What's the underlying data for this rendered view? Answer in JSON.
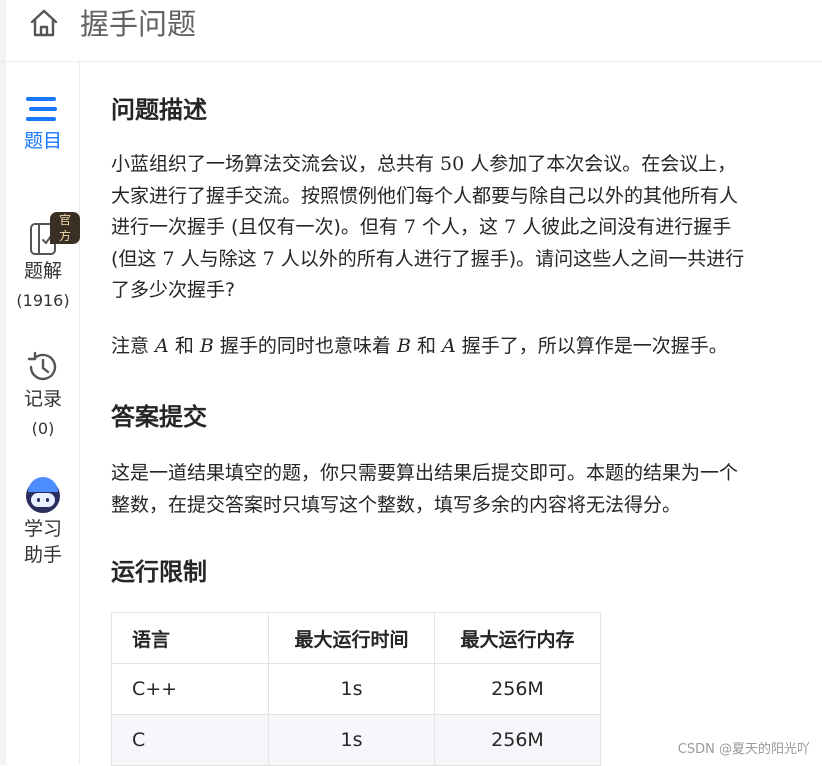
{
  "header": {
    "title": "握手问题",
    "home_icon": "home-icon"
  },
  "sidebar": {
    "accent_color": "#1677ff",
    "items": [
      {
        "id": "problem",
        "label": "题目",
        "icon": "list-icon",
        "active": true
      },
      {
        "id": "solutions",
        "label": "题解",
        "badge": "官方",
        "count": "(1916)",
        "icon": "solution-doc-icon"
      },
      {
        "id": "records",
        "label": "记录",
        "count": "(0)",
        "icon": "history-clock-icon"
      },
      {
        "id": "assistant",
        "label_line1": "学习",
        "label_line2": "助手",
        "icon": "robot-assistant-icon"
      }
    ]
  },
  "sections": {
    "description": {
      "title": "问题描述",
      "lines": [
        [
          "小蓝组织了一场算法交流会议，总共有 ",
          "50",
          " 人参加了本次会议。在会议上，"
        ],
        [
          "大家进行了握手交流。按照惯例他们每个人都要与除自己以外的其他所有人"
        ],
        [
          "进行一次握手 (且仅有一次)。但有 ",
          "7",
          " 个人，这 ",
          "7",
          " 人彼此之间没有进行握手"
        ],
        [
          "(但这 ",
          "7",
          " 人与除这 ",
          "7",
          " 人以外的所有人进行了握手)。请问这些人之间一共进行"
        ],
        [
          "了多少次握手?"
        ]
      ],
      "note": [
        "注意 ",
        "A",
        " 和 ",
        "B",
        " 握手的同时也意味着 ",
        "B",
        " 和 ",
        "A",
        " 握手了，所以算作是一次握手。"
      ]
    },
    "submission": {
      "title": "答案提交",
      "lines": [
        "这是一道结果填空的题，你只需要算出结果后提交即可。本题的结果为一个",
        "整数，在提交答案时只填写这个整数，填写多余的内容将无法得分。"
      ]
    },
    "limits": {
      "title": "运行限制",
      "columns": [
        "语言",
        "最大运行时间",
        "最大运行内存"
      ],
      "rows": [
        [
          "C++",
          "1s",
          "256M"
        ],
        [
          "C",
          "1s",
          "256M"
        ]
      ]
    }
  },
  "watermark": "CSDN @夏天的阳光吖"
}
